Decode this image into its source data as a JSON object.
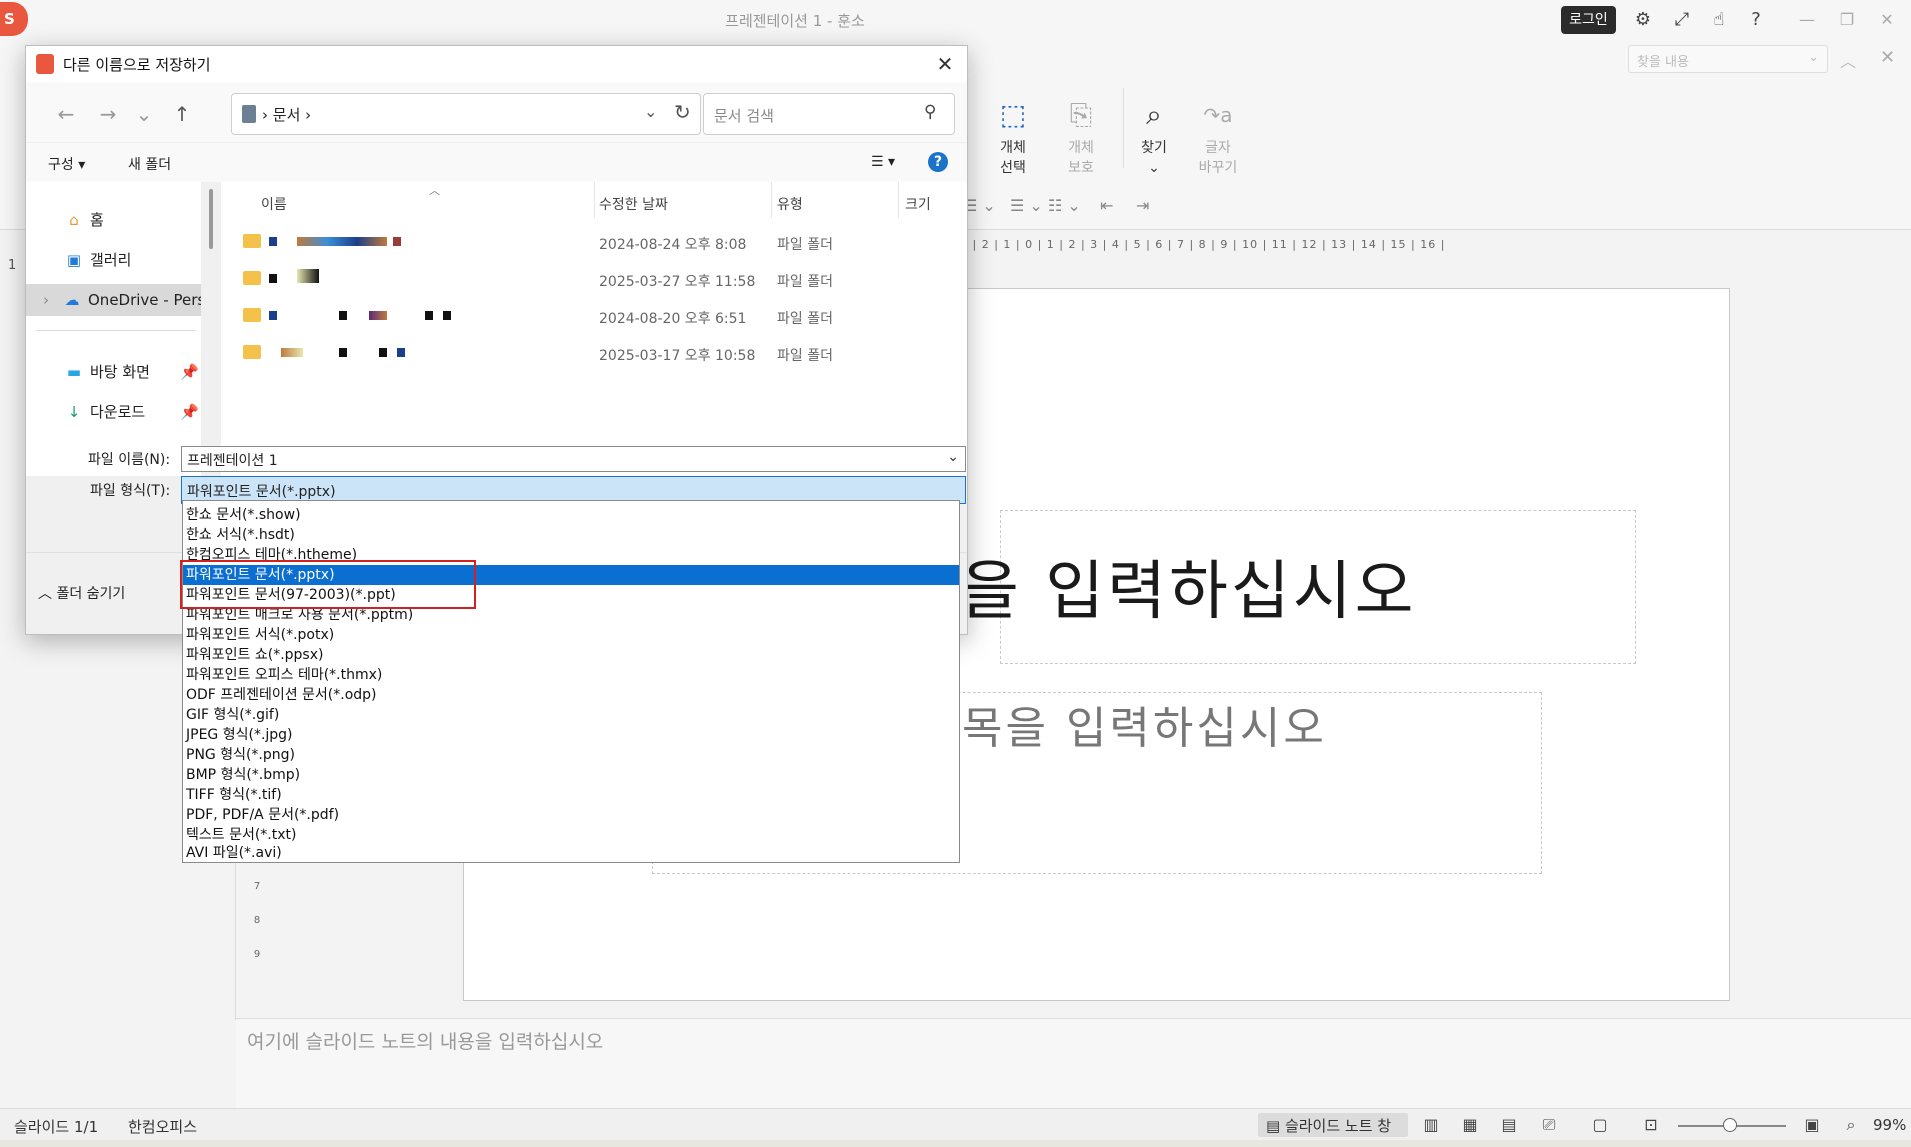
{
  "app": {
    "logo": "S",
    "title": "프레젠테이션 1 - 훈소",
    "login": "로그인",
    "find_placeholder": "찾을 내용"
  },
  "ribbon": {
    "object_select": [
      "개체",
      "선택"
    ],
    "object_protect": [
      "개체",
      "보호"
    ],
    "find": "찾기",
    "replace": [
      "글자",
      "바꾸기"
    ]
  },
  "slide": {
    "title_placeholder": "을 입력하십시오",
    "subtitle_placeholder": "목을 입력하십시오",
    "notes_placeholder": "여기에 슬라이드 노트의 내용을 입력하십시오",
    "thumb_number": "1"
  },
  "ruler": {
    "h": "3 | 2 | 1 | 0 | 1 | 2 | 3 | 4 | 5 | 6 | 7 | 8 | 9 | 10 | 11 | 12 | 13 | 14 | 15 | 16 |",
    "v": [
      "7",
      "8",
      "9"
    ]
  },
  "status": {
    "slide_info": "슬라이드 1/1",
    "app_name": "한컴오피스",
    "notes_toggle": "슬라이드 노트 창",
    "zoom": "99%"
  },
  "dialog": {
    "title": "다른 이름으로 저장하기",
    "address": "문서",
    "search_placeholder": "문서 검색",
    "organize": "구성",
    "new_folder": "새 폴더",
    "nav_items": [
      {
        "label": "홈",
        "icon": "home-icon"
      },
      {
        "label": "갤러리",
        "icon": "gallery-icon"
      },
      {
        "label": "OneDrive - Pers",
        "icon": "cloud-icon"
      },
      {
        "label": "바탕 화면",
        "icon": "desktop-icon"
      },
      {
        "label": "다운로드",
        "icon": "download-icon"
      }
    ],
    "columns": {
      "name": "이름",
      "modified": "수정한 날짜",
      "type": "유형",
      "size": "크기"
    },
    "files": [
      {
        "date": "2024-08-24 오후 8:08",
        "type": "파일 폴더"
      },
      {
        "date": "2025-03-27 오후 11:58",
        "type": "파일 폴더"
      },
      {
        "date": "2024-08-20 오후 6:51",
        "type": "파일 폴더"
      },
      {
        "date": "2025-03-17 오후 10:58",
        "type": "파일 폴더"
      }
    ],
    "file_name_label": "파일 이름(N):",
    "file_name_value": "프레젠테이션 1",
    "file_type_label": "파일 형식(T):",
    "file_type_value": "파워포인트 문서(*.pptx)",
    "hide_folders": "폴더 숨기기",
    "file_type_options": [
      "한쇼 문서(*.show)",
      "한쇼 서식(*.hsdt)",
      "한컴오피스 테마(*.htheme)",
      "파워포인트 문서(*.pptx)",
      "파워포인트 문서(97-2003)(*.ppt)",
      "파워포인트 매크로 사용 문서(*.pptm)",
      "파워포인트 서식(*.potx)",
      "파워포인트 쇼(*.ppsx)",
      "파워포인트 오피스 테마(*.thmx)",
      "ODF 프레젠테이션 문서(*.odp)",
      "GIF 형식(*.gif)",
      "JPEG 형식(*.jpg)",
      "PNG 형식(*.png)",
      "BMP 형식(*.bmp)",
      "TIFF 형식(*.tif)",
      "PDF, PDF/A 문서(*.pdf)",
      "텍스트 문서(*.txt)",
      "AVI 파일(*.avi)"
    ],
    "highlighted_option": "파워포인트 문서(*.pptx)"
  }
}
